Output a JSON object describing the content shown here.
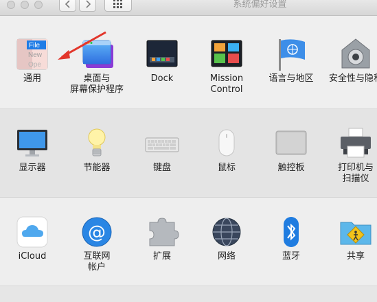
{
  "window": {
    "title": "系统偏好设置",
    "nav_back": "back",
    "nav_forward": "forward",
    "show_all": "grid"
  },
  "row1": [
    {
      "label": "通用",
      "icon": "general-icon",
      "icon_text": "File\nNew\nOpe"
    },
    {
      "label": "桌面与\n屏幕保护程序",
      "icon": "desktop-screensaver-icon"
    },
    {
      "label": "Dock",
      "icon": "dock-icon"
    },
    {
      "label": "Mission\nControl",
      "icon": "mission-control-icon"
    },
    {
      "label": "语言与地区",
      "icon": "language-region-icon"
    },
    {
      "label": "安全性与隐私",
      "icon": "security-privacy-icon"
    }
  ],
  "row2": [
    {
      "label": "显示器",
      "icon": "displays-icon"
    },
    {
      "label": "节能器",
      "icon": "energy-saver-icon"
    },
    {
      "label": "键盘",
      "icon": "keyboard-icon"
    },
    {
      "label": "鼠标",
      "icon": "mouse-icon"
    },
    {
      "label": "触控板",
      "icon": "trackpad-icon"
    },
    {
      "label": "打印机与\n扫描仪",
      "icon": "printers-scanners-icon"
    }
  ],
  "row3": [
    {
      "label": "iCloud",
      "icon": "icloud-icon"
    },
    {
      "label": "互联网\n帐户",
      "icon": "internet-accounts-icon"
    },
    {
      "label": "扩展",
      "icon": "extensions-icon"
    },
    {
      "label": "网络",
      "icon": "network-icon"
    },
    {
      "label": "蓝牙",
      "icon": "bluetooth-icon"
    },
    {
      "label": "共享",
      "icon": "sharing-icon"
    }
  ],
  "annotation": {
    "icon": "red-arrow-icon",
    "color": "#e2362b"
  }
}
